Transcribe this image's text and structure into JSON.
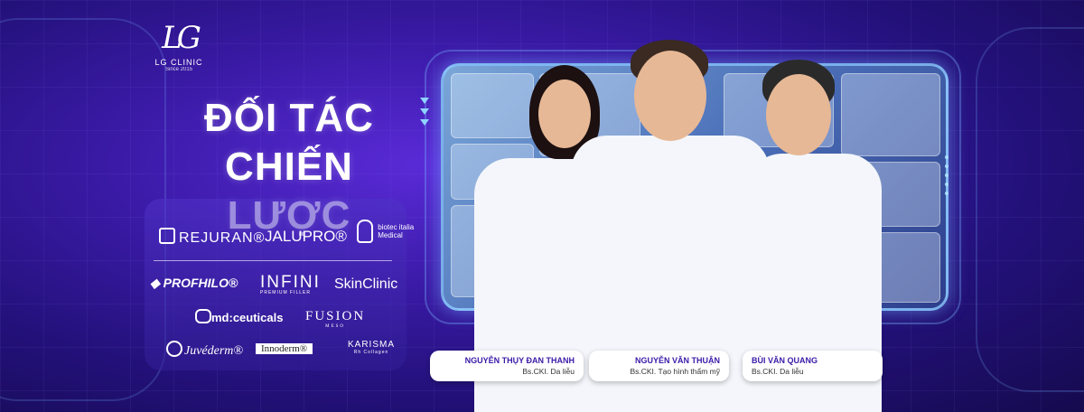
{
  "logo": {
    "mark": "LG",
    "name": "LG CLINIC",
    "since": "Since 2015"
  },
  "headline": {
    "line1": "ĐỐI TÁC",
    "line2": "CHIẾN LƯỢC"
  },
  "brands": {
    "rejuran": "REJURAN®",
    "jalupro": "JALUPRO®",
    "biotec": "biotec italia",
    "biotec_sub": "Medical",
    "profhilo": "PROFHILO®",
    "infini": "INFINI",
    "infini_sub": "PREMIUM FILLER",
    "skinclinic": "SkinClinic",
    "mdceuticals": "md:ceuticals",
    "fusion": "FUSION",
    "fusion_sub": "MESO",
    "juvederm": "Juvéderm®",
    "innoderm": "Innoderm®",
    "karisma": "KARISMA",
    "karisma_sub": "Rh Collagen"
  },
  "doctors": [
    {
      "name": "NGUYỄN THỤY ĐAN THANH",
      "role": "Bs.CKI. Da liễu"
    },
    {
      "name": "NGUYỄN VĂN THUẬN",
      "role": "Bs.CKI. Tạo hình thẩm mỹ"
    },
    {
      "name": "BÙI VĂN QUANG",
      "role": "Bs.CKI. Da liễu"
    }
  ],
  "colors": {
    "accent": "#3b1aa8",
    "background": "#2a1590",
    "neon": "#8fd3ff"
  }
}
